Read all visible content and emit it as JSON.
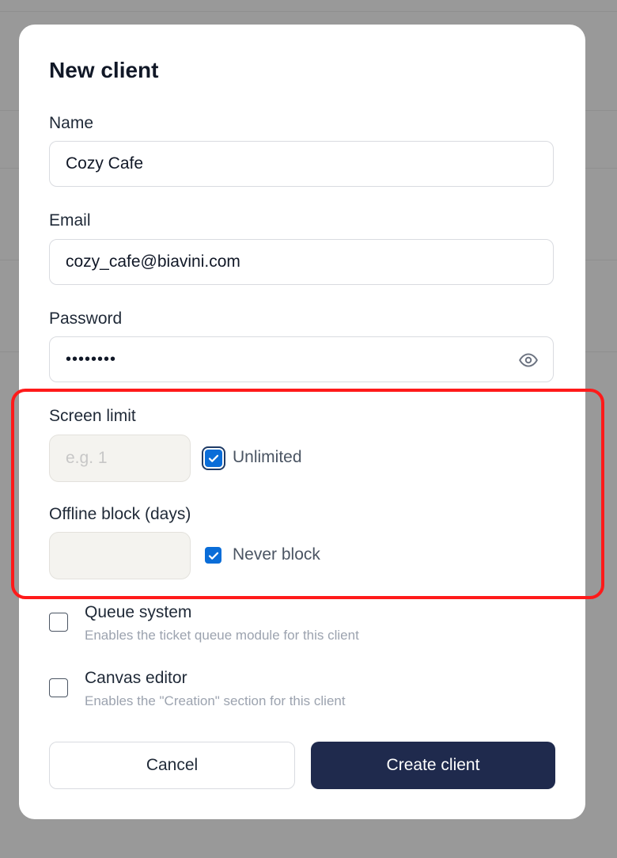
{
  "dialog": {
    "title": "New client",
    "name": {
      "label": "Name",
      "value": "Cozy Cafe"
    },
    "email": {
      "label": "Email",
      "value": "cozy_cafe@biavini.com"
    },
    "password": {
      "label": "Password",
      "value": "••••••••"
    },
    "screen_limit": {
      "label": "Screen limit",
      "placeholder": "e.g. 1",
      "value": "",
      "checkbox_label": "Unlimited",
      "checked": true
    },
    "offline_block": {
      "label": "Offline block (days)",
      "value": "",
      "checkbox_label": "Never block",
      "checked": true
    },
    "options": [
      {
        "title": "Queue system",
        "description": "Enables the ticket queue module for this client",
        "checked": false
      },
      {
        "title": "Canvas editor",
        "description": "Enables the \"Creation\" section for this client",
        "checked": false
      }
    ],
    "buttons": {
      "cancel": "Cancel",
      "create": "Create client"
    }
  },
  "colors": {
    "overlay": "#999999",
    "primary_button": "#1f2a4d",
    "checkbox": "#0a6dd8",
    "highlight": "#ff1a1a"
  },
  "icons": {
    "password_toggle": "eye-icon",
    "check": "check-icon"
  }
}
